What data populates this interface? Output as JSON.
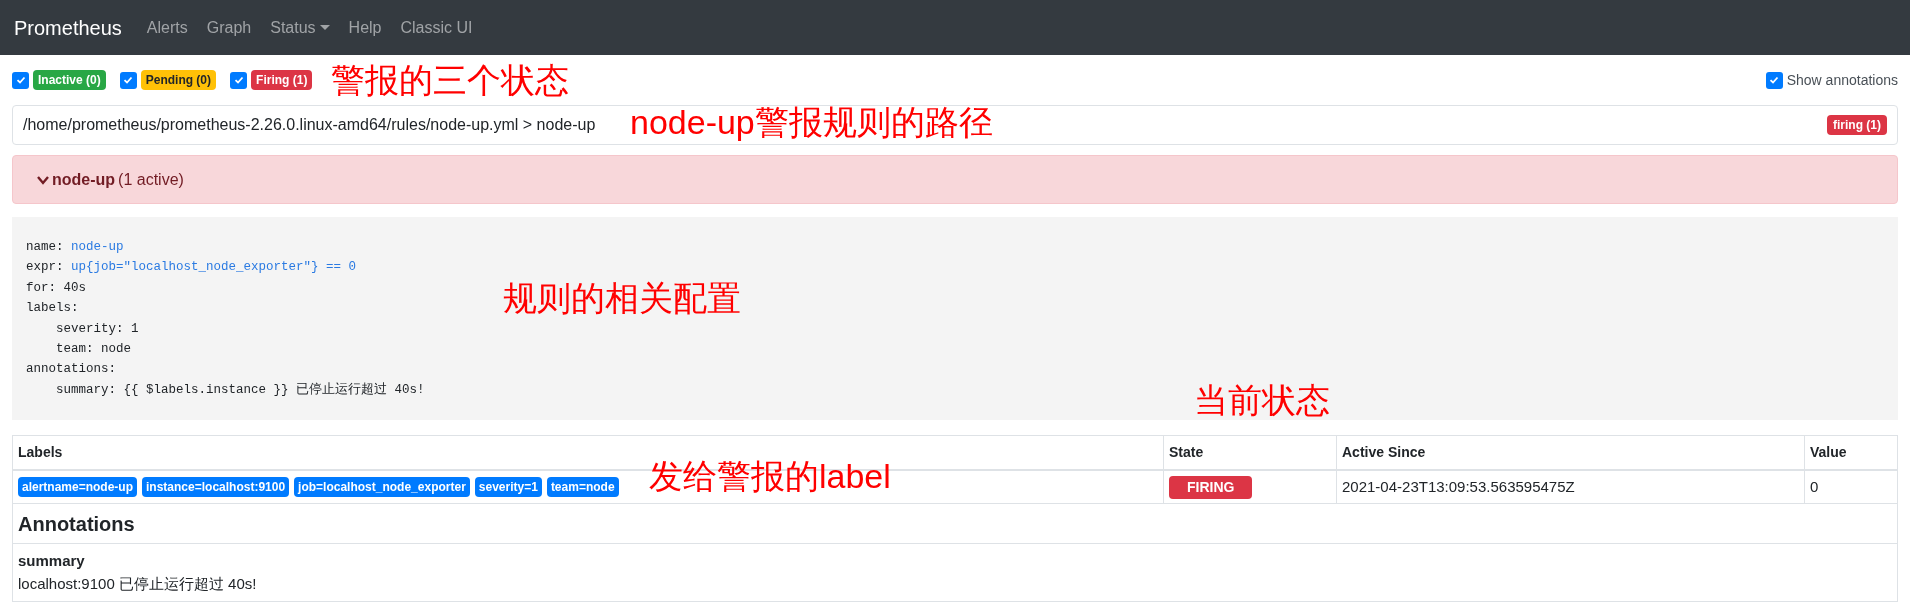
{
  "navbar": {
    "brand": "Prometheus",
    "links": [
      {
        "label": "Alerts",
        "dropdown": false
      },
      {
        "label": "Graph",
        "dropdown": false
      },
      {
        "label": "Status",
        "dropdown": true
      },
      {
        "label": "Help",
        "dropdown": false
      },
      {
        "label": "Classic UI",
        "dropdown": false
      }
    ]
  },
  "filters": [
    {
      "label": "Inactive (0)",
      "kind": "inactive",
      "checked": true
    },
    {
      "label": "Pending (0)",
      "kind": "pending",
      "checked": true
    },
    {
      "label": "Firing (1)",
      "kind": "firing",
      "checked": true
    }
  ],
  "show_annotations": {
    "label": "Show annotations",
    "checked": true
  },
  "rule_file": {
    "path": "/home/prometheus/prometheus-2.26.0.linux-amd64/rules/node-up.yml > node-up",
    "badge": "firing (1)"
  },
  "alert": {
    "name": "node-up",
    "count": "(1 active)",
    "expanded": true
  },
  "rule_definition": [
    {
      "key": "name:",
      "value": "node-up",
      "kind": "highlight"
    },
    {
      "key": "expr:",
      "value": "up{job=\"localhost_node_exporter\"} == 0",
      "kind": "highlight"
    },
    {
      "key": "for:",
      "value": "40s",
      "kind": "plain"
    },
    {
      "key": "labels:",
      "children": [
        {
          "key": "severity:",
          "value": "1",
          "kind": "plain"
        },
        {
          "key": "team:",
          "value": "node",
          "kind": "plain"
        }
      ]
    },
    {
      "key": "annotations:",
      "children": [
        {
          "key": "summary:",
          "value": "{{ $labels.instance }} 已停止运行超过 40s!",
          "kind": "plain"
        }
      ]
    }
  ],
  "table": {
    "columns": [
      "Labels",
      "State",
      "Active Since",
      "Value"
    ],
    "rows": [
      {
        "labels": [
          "alertname=node-up",
          "instance=localhost:9100",
          "job=localhost_node_exporter",
          "severity=1",
          "team=node"
        ],
        "state": "FIRING",
        "active_since": "2021-04-23T13:09:53.563595475Z",
        "value": "0"
      }
    ],
    "annotations_heading": "Annotations",
    "annotations": [
      {
        "name": "summary",
        "text": "localhost:9100 已停止运行超过 40s!"
      }
    ]
  },
  "overlay_notes": [
    "警报的三个状态",
    "node-up警报规则的路径",
    "规则的相关配置",
    "当前状态",
    "发给警报的label"
  ]
}
